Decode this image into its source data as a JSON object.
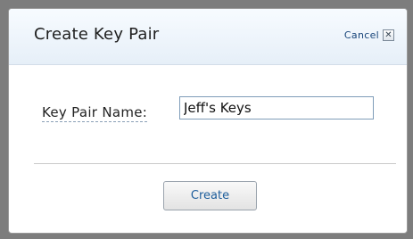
{
  "dialog": {
    "title": "Create Key Pair",
    "cancel_label": "Cancel",
    "close_glyph": "✕"
  },
  "form": {
    "key_pair_name_label": "Key Pair Name:",
    "key_pair_name_value": "Jeff's Keys"
  },
  "actions": {
    "create_label": "Create"
  }
}
